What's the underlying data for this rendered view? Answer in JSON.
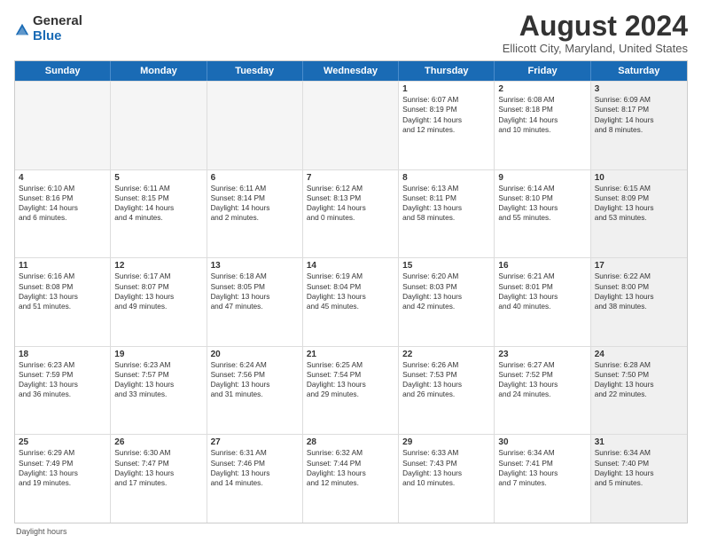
{
  "logo": {
    "general": "General",
    "blue": "Blue"
  },
  "header": {
    "title": "August 2024",
    "subtitle": "Ellicott City, Maryland, United States"
  },
  "days": [
    "Sunday",
    "Monday",
    "Tuesday",
    "Wednesday",
    "Thursday",
    "Friday",
    "Saturday"
  ],
  "footer": "Daylight hours",
  "rows": [
    [
      {
        "day": "",
        "empty": true
      },
      {
        "day": "",
        "empty": true
      },
      {
        "day": "",
        "empty": true
      },
      {
        "day": "",
        "empty": true
      },
      {
        "day": "1",
        "lines": [
          "Sunrise: 6:07 AM",
          "Sunset: 8:19 PM",
          "Daylight: 14 hours",
          "and 12 minutes."
        ]
      },
      {
        "day": "2",
        "lines": [
          "Sunrise: 6:08 AM",
          "Sunset: 8:18 PM",
          "Daylight: 14 hours",
          "and 10 minutes."
        ]
      },
      {
        "day": "3",
        "lines": [
          "Sunrise: 6:09 AM",
          "Sunset: 8:17 PM",
          "Daylight: 14 hours",
          "and 8 minutes."
        ],
        "shaded": true
      }
    ],
    [
      {
        "day": "4",
        "lines": [
          "Sunrise: 6:10 AM",
          "Sunset: 8:16 PM",
          "Daylight: 14 hours",
          "and 6 minutes."
        ]
      },
      {
        "day": "5",
        "lines": [
          "Sunrise: 6:11 AM",
          "Sunset: 8:15 PM",
          "Daylight: 14 hours",
          "and 4 minutes."
        ]
      },
      {
        "day": "6",
        "lines": [
          "Sunrise: 6:11 AM",
          "Sunset: 8:14 PM",
          "Daylight: 14 hours",
          "and 2 minutes."
        ]
      },
      {
        "day": "7",
        "lines": [
          "Sunrise: 6:12 AM",
          "Sunset: 8:13 PM",
          "Daylight: 14 hours",
          "and 0 minutes."
        ]
      },
      {
        "day": "8",
        "lines": [
          "Sunrise: 6:13 AM",
          "Sunset: 8:11 PM",
          "Daylight: 13 hours",
          "and 58 minutes."
        ]
      },
      {
        "day": "9",
        "lines": [
          "Sunrise: 6:14 AM",
          "Sunset: 8:10 PM",
          "Daylight: 13 hours",
          "and 55 minutes."
        ]
      },
      {
        "day": "10",
        "lines": [
          "Sunrise: 6:15 AM",
          "Sunset: 8:09 PM",
          "Daylight: 13 hours",
          "and 53 minutes."
        ],
        "shaded": true
      }
    ],
    [
      {
        "day": "11",
        "lines": [
          "Sunrise: 6:16 AM",
          "Sunset: 8:08 PM",
          "Daylight: 13 hours",
          "and 51 minutes."
        ]
      },
      {
        "day": "12",
        "lines": [
          "Sunrise: 6:17 AM",
          "Sunset: 8:07 PM",
          "Daylight: 13 hours",
          "and 49 minutes."
        ]
      },
      {
        "day": "13",
        "lines": [
          "Sunrise: 6:18 AM",
          "Sunset: 8:05 PM",
          "Daylight: 13 hours",
          "and 47 minutes."
        ]
      },
      {
        "day": "14",
        "lines": [
          "Sunrise: 6:19 AM",
          "Sunset: 8:04 PM",
          "Daylight: 13 hours",
          "and 45 minutes."
        ]
      },
      {
        "day": "15",
        "lines": [
          "Sunrise: 6:20 AM",
          "Sunset: 8:03 PM",
          "Daylight: 13 hours",
          "and 42 minutes."
        ]
      },
      {
        "day": "16",
        "lines": [
          "Sunrise: 6:21 AM",
          "Sunset: 8:01 PM",
          "Daylight: 13 hours",
          "and 40 minutes."
        ]
      },
      {
        "day": "17",
        "lines": [
          "Sunrise: 6:22 AM",
          "Sunset: 8:00 PM",
          "Daylight: 13 hours",
          "and 38 minutes."
        ],
        "shaded": true
      }
    ],
    [
      {
        "day": "18",
        "lines": [
          "Sunrise: 6:23 AM",
          "Sunset: 7:59 PM",
          "Daylight: 13 hours",
          "and 36 minutes."
        ]
      },
      {
        "day": "19",
        "lines": [
          "Sunrise: 6:23 AM",
          "Sunset: 7:57 PM",
          "Daylight: 13 hours",
          "and 33 minutes."
        ]
      },
      {
        "day": "20",
        "lines": [
          "Sunrise: 6:24 AM",
          "Sunset: 7:56 PM",
          "Daylight: 13 hours",
          "and 31 minutes."
        ]
      },
      {
        "day": "21",
        "lines": [
          "Sunrise: 6:25 AM",
          "Sunset: 7:54 PM",
          "Daylight: 13 hours",
          "and 29 minutes."
        ]
      },
      {
        "day": "22",
        "lines": [
          "Sunrise: 6:26 AM",
          "Sunset: 7:53 PM",
          "Daylight: 13 hours",
          "and 26 minutes."
        ]
      },
      {
        "day": "23",
        "lines": [
          "Sunrise: 6:27 AM",
          "Sunset: 7:52 PM",
          "Daylight: 13 hours",
          "and 24 minutes."
        ]
      },
      {
        "day": "24",
        "lines": [
          "Sunrise: 6:28 AM",
          "Sunset: 7:50 PM",
          "Daylight: 13 hours",
          "and 22 minutes."
        ],
        "shaded": true
      }
    ],
    [
      {
        "day": "25",
        "lines": [
          "Sunrise: 6:29 AM",
          "Sunset: 7:49 PM",
          "Daylight: 13 hours",
          "and 19 minutes."
        ]
      },
      {
        "day": "26",
        "lines": [
          "Sunrise: 6:30 AM",
          "Sunset: 7:47 PM",
          "Daylight: 13 hours",
          "and 17 minutes."
        ]
      },
      {
        "day": "27",
        "lines": [
          "Sunrise: 6:31 AM",
          "Sunset: 7:46 PM",
          "Daylight: 13 hours",
          "and 14 minutes."
        ]
      },
      {
        "day": "28",
        "lines": [
          "Sunrise: 6:32 AM",
          "Sunset: 7:44 PM",
          "Daylight: 13 hours",
          "and 12 minutes."
        ]
      },
      {
        "day": "29",
        "lines": [
          "Sunrise: 6:33 AM",
          "Sunset: 7:43 PM",
          "Daylight: 13 hours",
          "and 10 minutes."
        ]
      },
      {
        "day": "30",
        "lines": [
          "Sunrise: 6:34 AM",
          "Sunset: 7:41 PM",
          "Daylight: 13 hours",
          "and 7 minutes."
        ]
      },
      {
        "day": "31",
        "lines": [
          "Sunrise: 6:34 AM",
          "Sunset: 7:40 PM",
          "Daylight: 13 hours",
          "and 5 minutes."
        ],
        "shaded": true
      }
    ]
  ]
}
